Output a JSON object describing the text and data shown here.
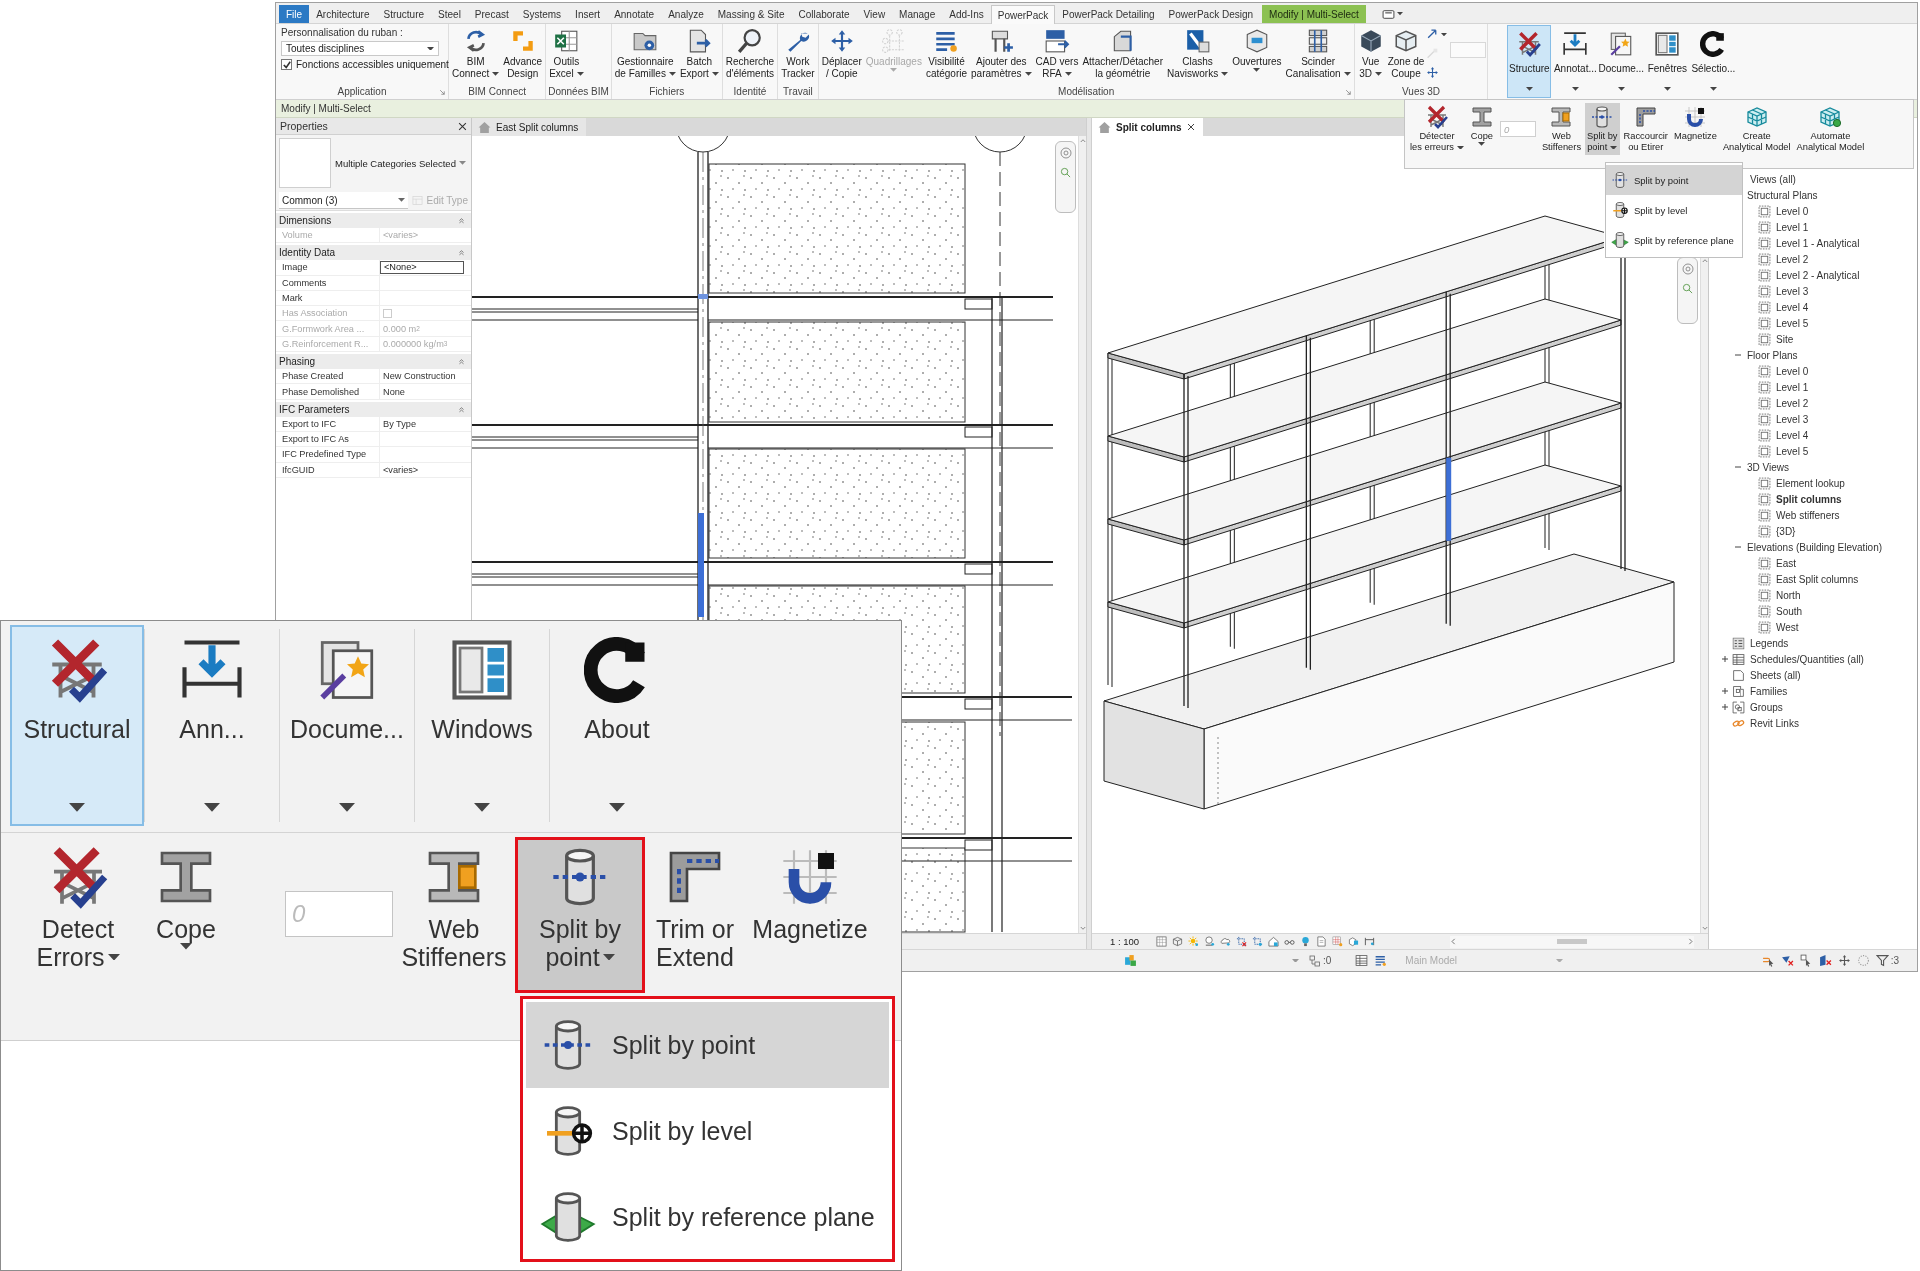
{
  "ribbon_tabs": [
    {
      "label": "File",
      "kind": "file",
      "selected": false
    },
    {
      "label": "Architecture",
      "kind": "tab",
      "selected": false
    },
    {
      "label": "Structure",
      "kind": "tab",
      "selected": false
    },
    {
      "label": "Steel",
      "kind": "tab",
      "selected": false
    },
    {
      "label": "Precast",
      "kind": "tab",
      "selected": false
    },
    {
      "label": "Systems",
      "kind": "tab",
      "selected": false
    },
    {
      "label": "Insert",
      "kind": "tab",
      "selected": false
    },
    {
      "label": "Annotate",
      "kind": "tab",
      "selected": false
    },
    {
      "label": "Analyze",
      "kind": "tab",
      "selected": false
    },
    {
      "label": "Massing & Site",
      "kind": "tab",
      "selected": false
    },
    {
      "label": "Collaborate",
      "kind": "tab",
      "selected": false
    },
    {
      "label": "View",
      "kind": "tab",
      "selected": false
    },
    {
      "label": "Manage",
      "kind": "tab",
      "selected": false
    },
    {
      "label": "Add-Ins",
      "kind": "tab",
      "selected": false
    },
    {
      "label": "PowerPack",
      "kind": "tab",
      "selected": true
    },
    {
      "label": "PowerPack Detailing",
      "kind": "tab",
      "selected": false
    },
    {
      "label": "PowerPack Design",
      "kind": "tab",
      "selected": false
    },
    {
      "label": "Modify | Multi-Select",
      "kind": "context",
      "selected": false
    }
  ],
  "application_panel": {
    "title": "Application",
    "launcher": true,
    "prompt": "Personnalisation du ruban :",
    "discipline": "Toutes disciplines",
    "option": {
      "label": "Fonctions accessibles uniquement",
      "checked": true
    }
  },
  "ribbon_panels": [
    {
      "title": "BIM Connect",
      "buttons": [
        {
          "kind": "large",
          "label": "BIM\nConnect",
          "dropdown": true,
          "disabled": false
        },
        {
          "kind": "large",
          "label": "Advance\nDesign",
          "dropdown": false,
          "disabled": false
        }
      ]
    },
    {
      "title": "Données BIM",
      "buttons": [
        {
          "kind": "large",
          "label": "Outils\nExcel",
          "dropdown": true,
          "disabled": false
        }
      ]
    },
    {
      "title": "Fichiers",
      "buttons": [
        {
          "kind": "large",
          "label": "Gestionnaire\nde Familles",
          "dropdown": true,
          "disabled": false
        },
        {
          "kind": "large",
          "label": "Batch\nExport",
          "dropdown": true,
          "disabled": false
        }
      ]
    },
    {
      "title": "Identité",
      "buttons": [
        {
          "kind": "large",
          "label": "Recherche\nd'éléments",
          "dropdown": false,
          "disabled": false
        }
      ]
    },
    {
      "title": "Travail",
      "buttons": [
        {
          "kind": "large",
          "label": "Work\nTracker",
          "dropdown": false,
          "disabled": false
        }
      ]
    },
    {
      "title": "Modélisation",
      "launcher": true,
      "buttons": [
        {
          "kind": "large",
          "label": "Déplacer\n/ Copie",
          "dropdown": false,
          "disabled": false
        },
        {
          "kind": "large",
          "label": "Quadrillages",
          "dropdown": true,
          "disabled": true
        },
        {
          "kind": "large",
          "label": "Visibilité\ncatégorie",
          "dropdown": false,
          "disabled": false
        },
        {
          "kind": "large",
          "label": "Ajouter des\nparamètres",
          "dropdown": true,
          "disabled": false
        },
        {
          "kind": "large",
          "label": "CAD vers\nRFA",
          "dropdown": true,
          "disabled": false
        },
        {
          "kind": "large",
          "label": "Attacher/Détacher\nla géométrie",
          "dropdown": false,
          "disabled": false
        },
        {
          "kind": "large",
          "label": "Clashs\nNavisworks",
          "dropdown": true,
          "disabled": false
        },
        {
          "kind": "large",
          "label": "Ouvertures",
          "dropdown": true,
          "disabled": false
        },
        {
          "kind": "large",
          "label": "Scinder\nCanalisation",
          "dropdown": true,
          "disabled": false
        }
      ]
    },
    {
      "title": "Vues 3D",
      "buttons": [
        {
          "kind": "large",
          "label": "Vue\n3D",
          "dropdown": true,
          "disabled": false
        },
        {
          "kind": "large",
          "label": "Zone de\nCoupe",
          "dropdown": false,
          "disabled": false
        },
        {
          "kind": "small_tools",
          "dropdown": true
        }
      ]
    }
  ],
  "tool_panel": {
    "buttons": [
      {
        "label": "Structure",
        "selected": true
      },
      {
        "label": "Annotat...",
        "selected": false
      },
      {
        "label": "Docume...",
        "selected": false
      },
      {
        "label": "Fenêtres",
        "selected": false
      },
      {
        "label": "Sélectio...",
        "selected": false
      }
    ]
  },
  "slideout": {
    "items": [
      {
        "kind": "button",
        "label": "Détecter\nles erreurs",
        "dropdown": true,
        "selected": false
      },
      {
        "kind": "button",
        "label": "Cope",
        "dropdown": true,
        "selected": false
      },
      {
        "kind": "field",
        "placeholder": "0"
      },
      {
        "kind": "button",
        "label": "Web\nStiffeners",
        "dropdown": false,
        "selected": false
      },
      {
        "kind": "button",
        "label": "Split by\npoint",
        "dropdown": true,
        "selected": true
      },
      {
        "kind": "button",
        "label": "Raccourcir\nou Etirer",
        "dropdown": false,
        "selected": false
      },
      {
        "kind": "button",
        "label": "Magnetize",
        "dropdown": false,
        "selected": false
      },
      {
        "kind": "button",
        "label": "Create\nAnalytical Model",
        "dropdown": false,
        "selected": false
      },
      {
        "kind": "button",
        "label": "Automate\nAnalytical Model",
        "dropdown": false,
        "selected": false
      }
    ],
    "menu": [
      {
        "label": "Split by point",
        "selected": true
      },
      {
        "label": "Split by level",
        "selected": false
      },
      {
        "label": "Split by reference plane",
        "selected": false
      }
    ]
  },
  "context_bar": "Modify | Multi-Select",
  "properties": {
    "title": "Properties",
    "type": "Multiple Categories Selected",
    "filter": "Common (3)",
    "edit_type": {
      "label": "Edit Type",
      "disabled": true
    },
    "groups": [
      {
        "title": "Dimensions",
        "rows": [
          {
            "name": "Volume",
            "kind": "text",
            "value": "<varies>",
            "disabled": true
          }
        ]
      },
      {
        "title": "Identity Data",
        "rows": [
          {
            "name": "Image",
            "kind": "field",
            "value": "<None>",
            "disabled": false
          },
          {
            "name": "Comments",
            "kind": "field",
            "disabled": false
          },
          {
            "name": "Mark",
            "kind": "field",
            "disabled": false
          },
          {
            "name": "Has Association",
            "kind": "checkbox",
            "checked": false,
            "disabled": true
          },
          {
            "name": "G.Formwork Area ...",
            "kind": "text",
            "value": "0.000 m$^{2}$",
            "disabled": true
          },
          {
            "name": "G.Reinforcement R...",
            "kind": "text",
            "value": "0.000000 kg/m$^{3}$",
            "disabled": true
          }
        ]
      },
      {
        "title": "Phasing",
        "rows": [
          {
            "name": "Phase Created",
            "kind": "text",
            "value": "New Construction",
            "disabled": false
          },
          {
            "name": "Phase Demolished",
            "kind": "text",
            "value": "None",
            "disabled": false
          }
        ]
      },
      {
        "title": "IFC Parameters",
        "rows": [
          {
            "name": "Export to IFC",
            "kind": "text",
            "value": "By Type",
            "disabled": false
          },
          {
            "name": "Export to IFC As",
            "kind": "field",
            "disabled": false
          },
          {
            "name": "IFC Predefined Type",
            "kind": "field",
            "disabled": false
          },
          {
            "name": "IfcGUID",
            "kind": "text",
            "value": "<varies>",
            "disabled": false
          }
        ]
      }
    ]
  },
  "views": [
    {
      "title": "East Split columns",
      "kind": "elevation",
      "selected": false
    },
    {
      "title": "Split columns",
      "kind": "isometric",
      "selected": true,
      "scale": "1 : 100"
    }
  ],
  "browser": {
    "tree": [
      {
        "label": "Views (all)",
        "selected": false,
        "children": [
          {
            "label": "Structural Plans",
            "selected": false,
            "children": [
              {
                "label": "Level 0",
                "selected": false
              },
              {
                "label": "Level 1",
                "selected": false
              },
              {
                "label": "Level 1 - Analytical",
                "selected": false
              },
              {
                "label": "Level 2",
                "selected": false
              },
              {
                "label": "Level 2 - Analytical",
                "selected": false
              },
              {
                "label": "Level 3",
                "selected": false
              },
              {
                "label": "Level 4",
                "selected": false
              },
              {
                "label": "Level 5",
                "selected": false
              },
              {
                "label": "Site",
                "selected": false
              }
            ]
          },
          {
            "label": "Floor Plans",
            "expanded": true,
            "selected": false,
            "children": [
              {
                "label": "Level 0",
                "selected": false
              },
              {
                "label": "Level 1",
                "selected": false
              },
              {
                "label": "Level 2",
                "selected": false
              },
              {
                "label": "Level 3",
                "selected": false
              },
              {
                "label": "Level 4",
                "selected": false
              },
              {
                "label": "Level 5",
                "selected": false
              }
            ]
          },
          {
            "label": "3D Views",
            "expanded": true,
            "selected": false,
            "children": [
              {
                "label": "Element lookup",
                "selected": false
              },
              {
                "label": "Split columns",
                "selected": true
              },
              {
                "label": "Web stiffeners",
                "selected": false
              },
              {
                "label": "{3D}",
                "selected": false
              }
            ]
          },
          {
            "label": "Elevations (Building Elevation)",
            "expanded": true,
            "selected": false,
            "children": [
              {
                "label": "East",
                "selected": false
              },
              {
                "label": "East Split columns",
                "selected": false
              },
              {
                "label": "North",
                "selected": false
              },
              {
                "label": "South",
                "selected": false
              },
              {
                "label": "West",
                "selected": false
              }
            ]
          }
        ]
      },
      {
        "label": "Legends",
        "selected": false
      },
      {
        "label": "Schedules/Quantities (all)",
        "expanded": false,
        "selected": false
      },
      {
        "label": "Sheets (all)",
        "selected": false
      },
      {
        "label": "Families",
        "expanded": false,
        "selected": false
      },
      {
        "label": "Groups",
        "expanded": false,
        "selected": false
      },
      {
        "label": "Revit Links",
        "selected": false
      }
    ]
  },
  "status_bar": {
    "first_counter": ":0",
    "model": "Main Model",
    "filter_counter": ":3"
  },
  "zoom_inset": {
    "tabs": [
      {
        "label": "Structural",
        "selected": true
      },
      {
        "label": "Ann...",
        "selected": false
      },
      {
        "label": "Docume...",
        "selected": false
      },
      {
        "label": "Windows",
        "selected": false
      },
      {
        "label": "About",
        "selected": false
      }
    ],
    "tools": [
      {
        "kind": "button",
        "label": "Detect\nErrors",
        "dropdown": true,
        "selected": false,
        "highlighted": false
      },
      {
        "kind": "button",
        "label": "Cope",
        "dropdown": true,
        "selected": false,
        "highlighted": false
      },
      {
        "kind": "field",
        "placeholder": "0"
      },
      {
        "kind": "button",
        "label": "Web\nStiffeners",
        "dropdown": false,
        "selected": false,
        "highlighted": false
      },
      {
        "kind": "button",
        "label": "Split by\npoint",
        "dropdown": true,
        "selected": true,
        "highlighted": true
      },
      {
        "kind": "button",
        "label": "Trim or\nExtend",
        "dropdown": false,
        "selected": false,
        "highlighted": false
      },
      {
        "kind": "button",
        "label": "Magnetize",
        "dropdown": false,
        "selected": false,
        "highlighted": false
      }
    ],
    "menu": {
      "highlighted": true,
      "items": [
        {
          "label": "Split by point",
          "selected": true
        },
        {
          "label": "Split by level",
          "selected": false
        },
        {
          "label": "Split by reference plane",
          "selected": false
        }
      ]
    }
  }
}
